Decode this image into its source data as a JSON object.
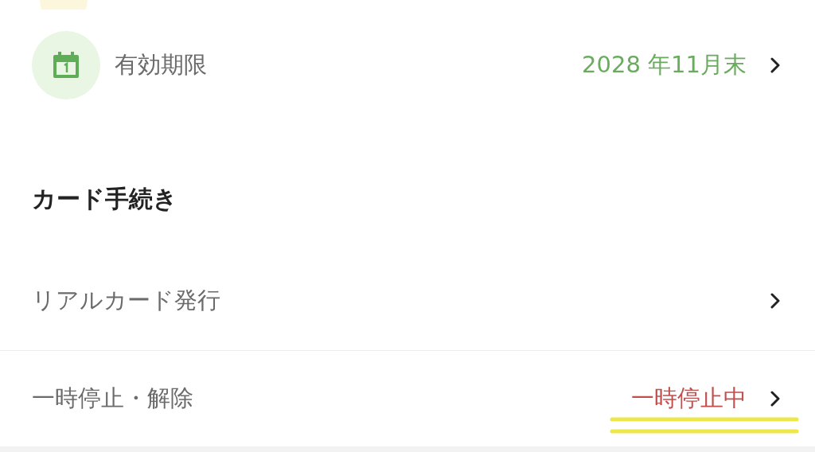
{
  "expiry": {
    "label": "有効期限",
    "value": "2028 年11月末"
  },
  "section": {
    "title": "カード手続き",
    "items": [
      {
        "label": "リアルカード発行"
      },
      {
        "label": "一時停止・解除",
        "status": "一時停止中",
        "highlighted": true
      }
    ]
  }
}
